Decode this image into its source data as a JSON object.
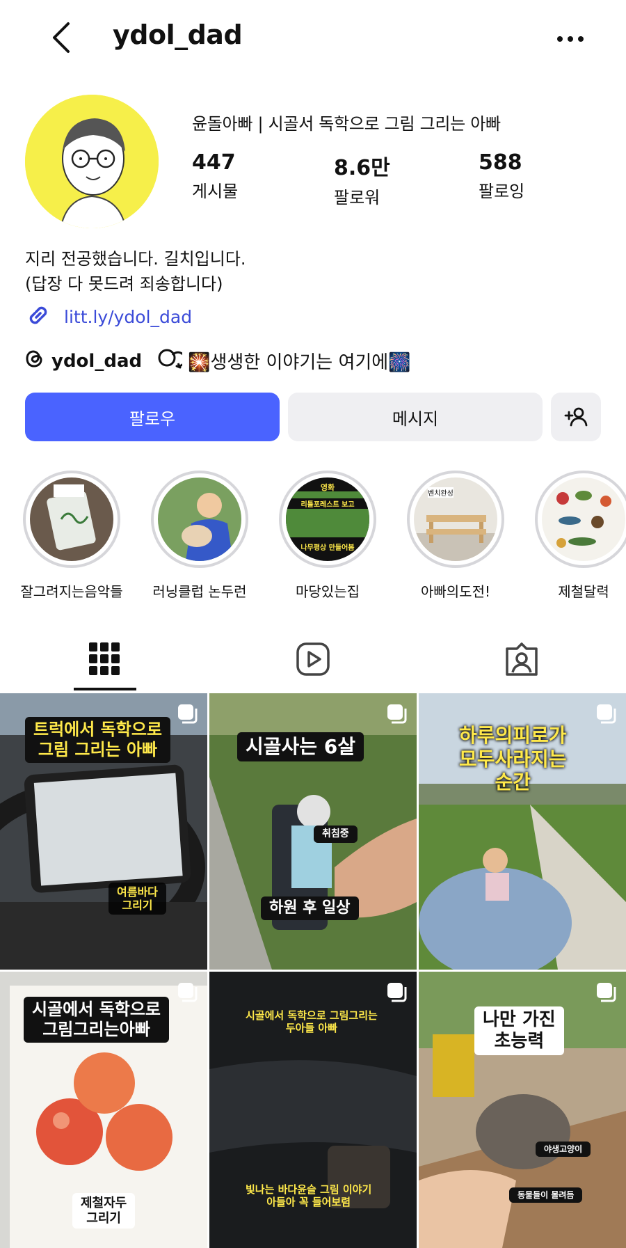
{
  "header": {
    "username": "ydol_dad"
  },
  "profile": {
    "display_name": "윤돌아빠 | 시골서 독학으로 그림 그리는 아빠",
    "stats": [
      {
        "value": "447",
        "label": "게시물"
      },
      {
        "value": "8.6만",
        "label": "팔로워"
      },
      {
        "value": "588",
        "label": "팔로잉"
      }
    ],
    "bio_line1": "지리 전공했습니다. 길치입니다.",
    "bio_line2": "(답장 다 못드려 죄송합니다)",
    "link": "litt.ly/ydol_dad",
    "threads_handle": "ydol_dad",
    "threads_text": "🎇생생한 이야기는 여기에🎆"
  },
  "buttons": {
    "follow": "팔로우",
    "message": "메시지"
  },
  "highlights": [
    {
      "label": "잘그려지는음악들",
      "inner_text": ""
    },
    {
      "label": "러닝클럽 논두런",
      "inner_text": ""
    },
    {
      "label": "마당있는집",
      "inner_text_top": "영화",
      "inner_text_mid": "리틀포레스트 보고",
      "inner_text_bot": "나무평상 만들어봄"
    },
    {
      "label": "아빠의도전!",
      "inner_text": "벤치완성"
    },
    {
      "label": "제철달력",
      "inner_text": ""
    }
  ],
  "posts": [
    {
      "caption": "트럭에서 독학으로\n그림 그리는 아빠",
      "sub": "여름바다\n그리기"
    },
    {
      "caption": "시골사는 6살",
      "sub": "하원 후 일상",
      "tag": "취침중"
    },
    {
      "caption": "하루의피로가\n모두사라지는\n순간"
    },
    {
      "caption": "시골에서 독학으로\n그림그리는아빠",
      "sub": "제철자두\n그리기"
    },
    {
      "caption": "시골에서 독학으로 그림그리는\n두아들 아빠",
      "sub": "빛나는 바다윤슬 그림 이야기\n아들아 꼭 들어보렴"
    },
    {
      "caption": "나만 가진\n초능력",
      "tag": "야생고양이",
      "sub": "동물들이 몰려듬"
    }
  ]
}
